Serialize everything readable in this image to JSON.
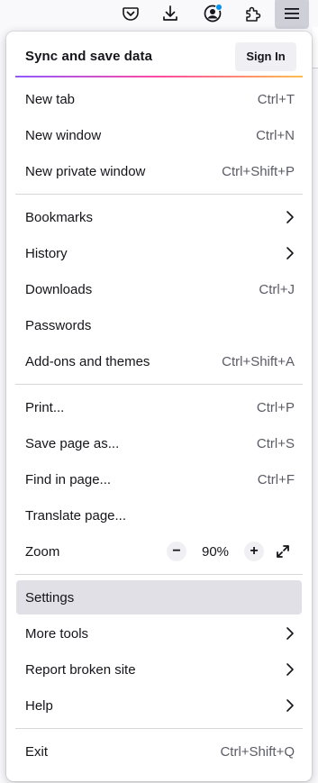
{
  "toolbar": {
    "icons": [
      "pocket-icon",
      "download-icon",
      "account-icon",
      "extensions-icon",
      "hamburger-menu-icon"
    ],
    "account_badge_color": "#0090ed"
  },
  "menu": {
    "sync": {
      "label": "Sync and save data",
      "button": "Sign In"
    },
    "items": [
      {
        "label": "New tab",
        "shortcut": "Ctrl+T"
      },
      {
        "label": "New window",
        "shortcut": "Ctrl+N"
      },
      {
        "label": "New private window",
        "shortcut": "Ctrl+Shift+P"
      },
      {
        "label": "Bookmarks",
        "submenu": true
      },
      {
        "label": "History",
        "submenu": true
      },
      {
        "label": "Downloads",
        "shortcut": "Ctrl+J"
      },
      {
        "label": "Passwords"
      },
      {
        "label": "Add-ons and themes",
        "shortcut": "Ctrl+Shift+A"
      },
      {
        "label": "Print...",
        "shortcut": "Ctrl+P"
      },
      {
        "label": "Save page as...",
        "shortcut": "Ctrl+S"
      },
      {
        "label": "Find in page...",
        "shortcut": "Ctrl+F"
      },
      {
        "label": "Translate page..."
      },
      {
        "label": "Zoom"
      },
      {
        "label": "Settings",
        "highlighted": true
      },
      {
        "label": "More tools",
        "submenu": true
      },
      {
        "label": "Report broken site",
        "submenu": true
      },
      {
        "label": "Help",
        "submenu": true
      },
      {
        "label": "Exit",
        "shortcut": "Ctrl+Shift+Q"
      }
    ],
    "zoom": {
      "minus": "−",
      "value": "90%",
      "plus": "+"
    }
  }
}
